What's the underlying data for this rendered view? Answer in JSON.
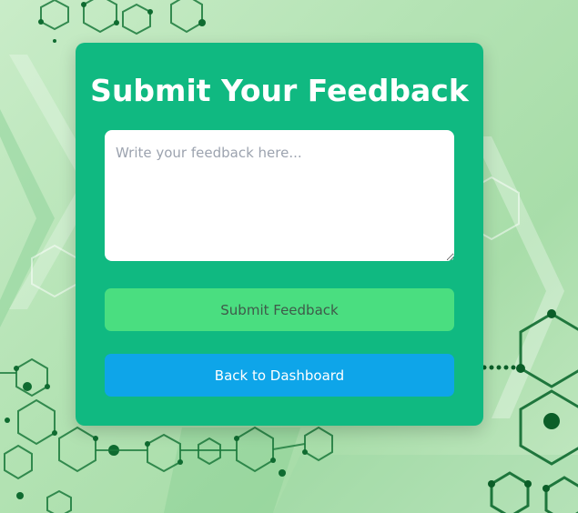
{
  "form": {
    "title": "Submit Your Feedback",
    "textarea_placeholder": "Write your feedback here...",
    "textarea_value": "",
    "submit_label": "Submit Feedback",
    "back_label": "Back to Dashboard"
  },
  "colors": {
    "card": "#10b981",
    "submit_button": "#4ade80",
    "back_button": "#0ea5e9",
    "background": "#b4e3b4"
  }
}
